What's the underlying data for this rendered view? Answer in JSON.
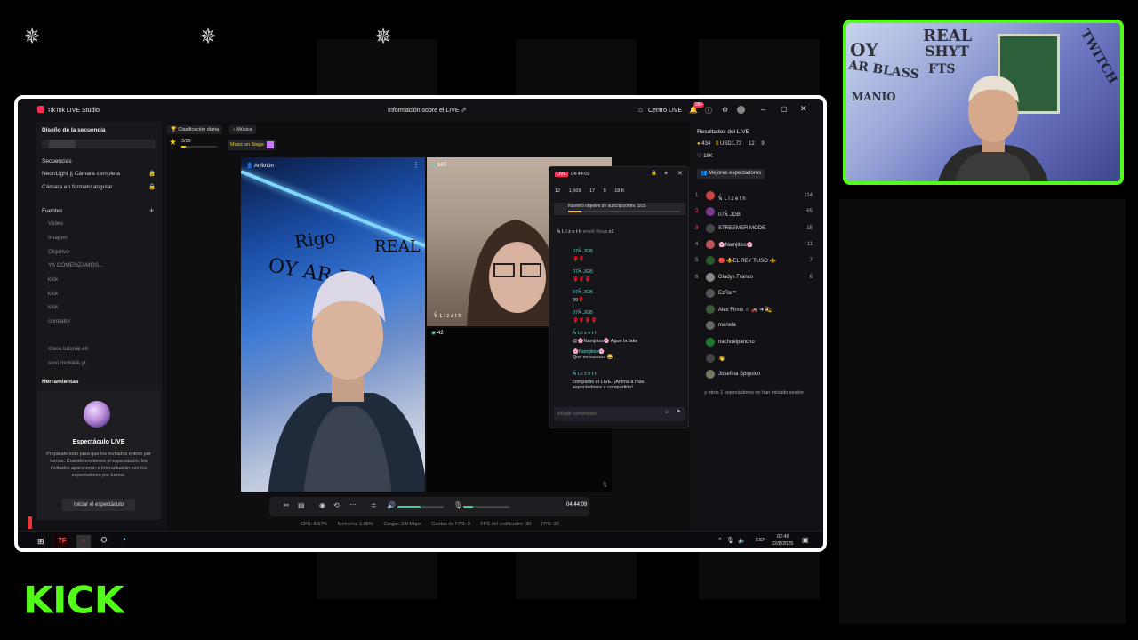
{
  "overlay": {
    "brand_icon": "nine-pointed-star-icon",
    "kick_text": "KICK",
    "accent": "#53fc18"
  },
  "webcam": {
    "graffiti": [
      "OY",
      "AR BLASS",
      "MANIO",
      "REAL",
      "SHYT",
      "FTS",
      "TWITCH"
    ]
  },
  "app": {
    "title": "TikTok LIVE Studio",
    "live_info": "Información sobre el LIVE",
    "live_center": "Centro LIVE",
    "notif_badge": "99+"
  },
  "left": {
    "scene_design": "Diseño de la secuencia",
    "sequences_label": "Secuencias",
    "sequences": [
      "NeonLight || Cámara completa",
      "Cámara en formato angular"
    ],
    "sources_label": "Fuentes",
    "sources": [
      "Vídeo",
      "Imagen",
      "Objetivo",
      "YA COMENZAMOS...",
      "kick",
      "kick",
      "kick",
      "contador",
      "",
      "chica tutorial.elt",
      "soul.mobikik.yt"
    ],
    "tools_label": "Herramientas",
    "spectacle_title": "Espectáculo LIVE",
    "spectacle_desc": "Prepáralo todo para que los invitados entren por turnos. Cuando empieces el espectáculo, los invitados aparecerán e interactuarán con los espectadores por turnos.",
    "start_button": "Iniciar el espectáculo"
  },
  "center": {
    "top_tabs": [
      "Clasificación diaria",
      "Música"
    ],
    "goal_progress": "3/25",
    "music_on_stage": "Music on Stage",
    "host_label": "Anfitrión",
    "guest1_count": "183",
    "guest1_name": "ꫝ L i z e t h",
    "guest2_count": "42",
    "timer": "04:44:09"
  },
  "chat": {
    "live_badge": "LIVE",
    "duration": "04:44:09",
    "stats": [
      "12",
      "1,669",
      "17",
      "9",
      "18 K"
    ],
    "goal_text": "Número objetivo de suscripciones: 3/25",
    "gift_line": "ꫝ L i z e t h",
    "gift_sent": "envió Rosa",
    "gift_count": "x1",
    "messages": [
      {
        "user": "07ꫝ.JGB",
        "text": "🌹🌹"
      },
      {
        "user": "07ꫝ.JGB",
        "text": "🌹🌹🌹"
      },
      {
        "user": "07ꫝ.JGB",
        "text": "99🌹"
      },
      {
        "user": "07ꫝ.JGB",
        "text": "🌹🌹🌹🌹"
      },
      {
        "user": "ꫝ L i z e t h",
        "text": "@🌸Namjitiss🌸 Ague la fake"
      },
      {
        "user": "🌸Namjitiss🌸",
        "text": "Que es esoooo 😂"
      },
      {
        "user": "ꫝ L i z e t h",
        "text": "compartió el LIVE. ¡Anima a más espectadores a compartirlo!"
      }
    ],
    "placeholder": "Añadir comentario"
  },
  "right": {
    "title": "Resultados del LIVE",
    "stats": [
      "434",
      "USD1.73",
      "12",
      "9",
      "18K"
    ],
    "tab": "Mejores espectadores",
    "viewers": [
      {
        "rank": "1",
        "name": "ꫝ L i z e t h",
        "score": "114"
      },
      {
        "rank": "2",
        "name": "07ꫝ.JGB",
        "score": "65"
      },
      {
        "rank": "3",
        "name": "STREEMER MODE",
        "score": "15"
      },
      {
        "rank": "4",
        "name": "🌸Namjitiss🌸",
        "score": "11"
      },
      {
        "rank": "5",
        "name": "🔴 ⚜️EL REY TUSO ⚜️",
        "score": "7"
      },
      {
        "rank": "6",
        "name": "Gladys Franco",
        "score": "6"
      },
      {
        "rank": "",
        "name": "EzRa™",
        "score": ""
      },
      {
        "rank": "",
        "name": "Alex Firms ☆ 🚗 ➜ 💫",
        "score": ""
      },
      {
        "rank": "",
        "name": "mariela",
        "score": ""
      },
      {
        "rank": "",
        "name": "nachoelpancho",
        "score": ""
      },
      {
        "rank": "",
        "name": "👋",
        "score": ""
      },
      {
        "rank": "",
        "name": "Josefina Spigolon",
        "score": ""
      }
    ],
    "footer": "y otros 1 espectadores no han iniciado sesión"
  },
  "status": {
    "cpu": "CPU: 8.67%",
    "memory": "Memoria: 1.85%",
    "upload": "Cargar: 2.8 Mbps",
    "dropped": "Caídas de FPS: 0",
    "fps_codec": "FPS del codificador: 30",
    "fps": "FPS: 30"
  },
  "taskbar": {
    "lang": "ESP",
    "time": "02:48",
    "date": "22/8/2025"
  }
}
